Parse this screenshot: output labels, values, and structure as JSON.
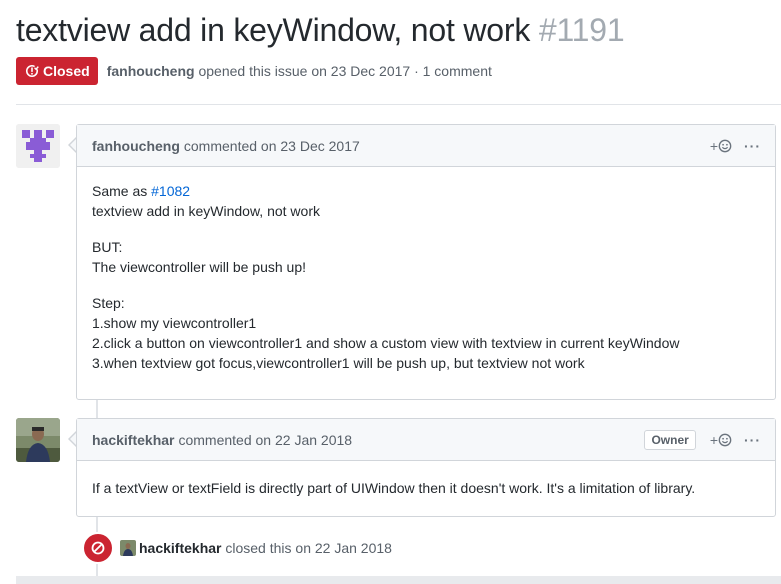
{
  "issue": {
    "title": "textview add in keyWindow, not work",
    "number": "#1191",
    "state_label": "Closed",
    "author": "fanhoucheng",
    "opened_text": "opened this issue on 23 Dec 2017 · 1 comment"
  },
  "comments": [
    {
      "author": "fanhoucheng",
      "meta": "commented on 23 Dec 2017",
      "add_reaction": "+",
      "more": "···",
      "paragraphs": [
        {
          "prefix": "Same as ",
          "link": "#1082",
          "rest": "textview add in keyWindow, not work"
        },
        {
          "line1": "BUT:",
          "line2": "The viewcontroller will be push up!"
        },
        {
          "line1": "Step:",
          "line2": "1.show my viewcontroller1",
          "line3": "2.click a button on viewcontroller1 and show a custom view with textview in current keyWindow",
          "line4": "3.when textview got focus,viewcontroller1 will be push up, but textview not work"
        }
      ]
    },
    {
      "author": "hackiftekhar",
      "meta": "commented on 22 Jan 2018",
      "role_badge": "Owner",
      "add_reaction": "+",
      "more": "···",
      "body": "If a textView or textField is directly part of UIWindow then it doesn't work. It's a limitation of library."
    }
  ],
  "event": {
    "actor": "hackiftekhar",
    "text": "closed this on 22 Jan 2018"
  },
  "colors": {
    "closed_red": "#cb2431",
    "link_blue": "#0366d6",
    "identicon_purple": "#8a5cd6"
  },
  "icons": {
    "state": "issue-closed-icon",
    "reaction": "smiley-icon",
    "event": "circle-slash-icon"
  }
}
